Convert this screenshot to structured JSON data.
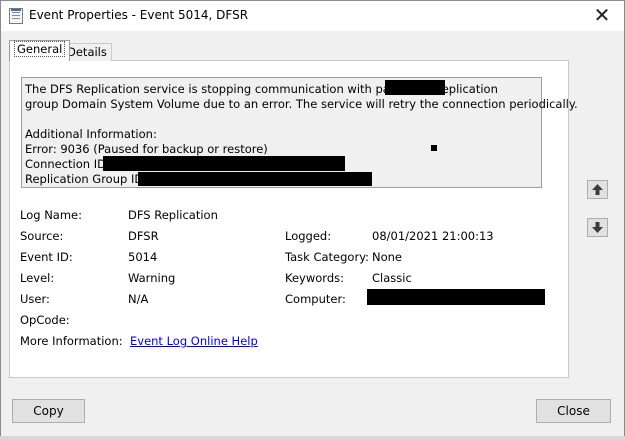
{
  "window": {
    "title": "Event Properties - Event 5014, DFSR",
    "close_glyph": "✕"
  },
  "tabs": {
    "general": "General",
    "details": "Details"
  },
  "description": {
    "line1": "The DFS Replication service is stopping communication with partner                     or replication",
    "line2": "group Domain System Volume due to an error. The service will retry the connection periodically.",
    "line3": "Additional Information:",
    "line4": "Error: 9036 (Paused for backup or restore)",
    "line5": "Connection ID:",
    "line6": "Replication Group ID:"
  },
  "fields": {
    "log_name_label": "Log Name:",
    "log_name_value": "DFS Replication",
    "source_label": "Source:",
    "source_value": "DFSR",
    "logged_label": "Logged:",
    "logged_value": "08/01/2021 21:00:13",
    "event_id_label": "Event ID:",
    "event_id_value": "5014",
    "task_category_label": "Task Category:",
    "task_category_value": "None",
    "level_label": "Level:",
    "level_value": "Warning",
    "keywords_label": "Keywords:",
    "keywords_value": "Classic",
    "user_label": "User:",
    "user_value": "N/A",
    "computer_label": "Computer:",
    "opcode_label": "OpCode:",
    "more_info_label": "More Information:",
    "more_info_link": "Event Log Online Help"
  },
  "buttons": {
    "copy": "Copy",
    "close": "Close"
  },
  "colors": {
    "dialog_background": "#f0f0f0",
    "link": "#0000e0",
    "redaction": "#000000"
  }
}
